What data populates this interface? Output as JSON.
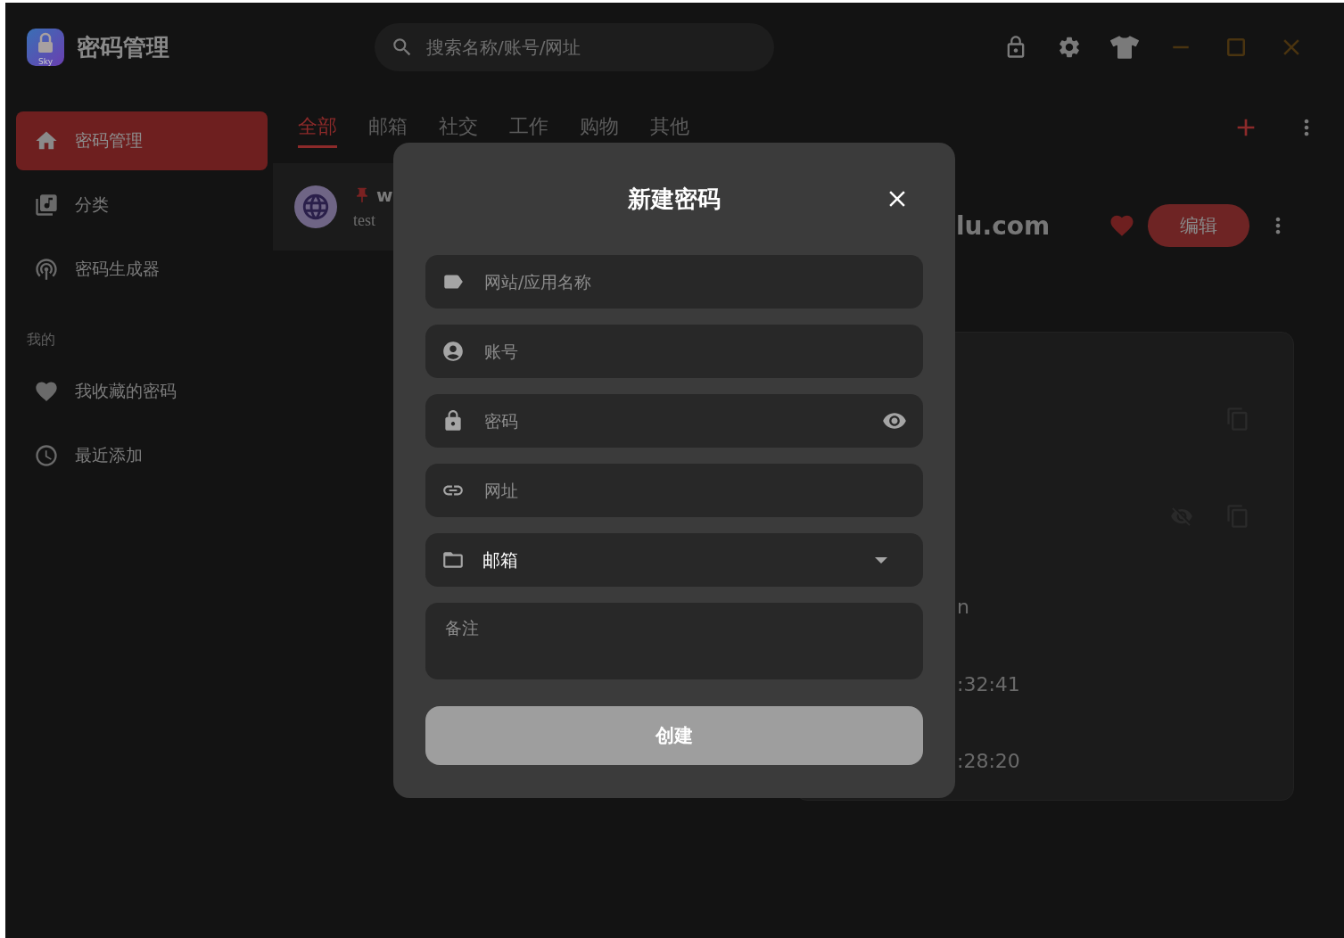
{
  "app": {
    "title": "密码管理",
    "logo_text": "Sky"
  },
  "search": {
    "placeholder": "搜索名称/账号/网址"
  },
  "sidebar": {
    "items": [
      {
        "label": "密码管理",
        "selected": true
      },
      {
        "label": "分类",
        "selected": false
      },
      {
        "label": "密码生成器",
        "selected": false
      }
    ],
    "section": "我的",
    "section_items": [
      {
        "label": "我收藏的密码",
        "selected": false
      },
      {
        "label": "最近添加",
        "selected": false
      }
    ]
  },
  "tabs": [
    {
      "label": "全部",
      "selected": true
    },
    {
      "label": "邮箱",
      "selected": false
    },
    {
      "label": "社交",
      "selected": false
    },
    {
      "label": "工作",
      "selected": false
    },
    {
      "label": "购物",
      "selected": false
    },
    {
      "label": "其他",
      "selected": false
    }
  ],
  "list": [
    {
      "title": "w",
      "subtitle": "test",
      "pinned": true
    }
  ],
  "detail": {
    "title": "lu.com",
    "favorite": true,
    "edit_button": "编辑",
    "rows": [
      {
        "kind": "copy"
      },
      {
        "kind": "secret"
      },
      {
        "kind": "text",
        "value": "n"
      },
      {
        "kind": "text",
        "value": ":32:41"
      },
      {
        "kind": "text",
        "value": ":28:20"
      }
    ]
  },
  "dialog": {
    "title": "新建密码",
    "fields": [
      {
        "kind": "text",
        "placeholder": "网站/应用名称"
      },
      {
        "kind": "text",
        "placeholder": "账号"
      },
      {
        "kind": "password",
        "placeholder": "密码"
      },
      {
        "kind": "text",
        "placeholder": "网址"
      },
      {
        "kind": "select",
        "value": "邮箱"
      },
      {
        "kind": "textarea",
        "placeholder": "备注"
      }
    ],
    "submit": {
      "label": "创建",
      "disabled": true
    }
  }
}
